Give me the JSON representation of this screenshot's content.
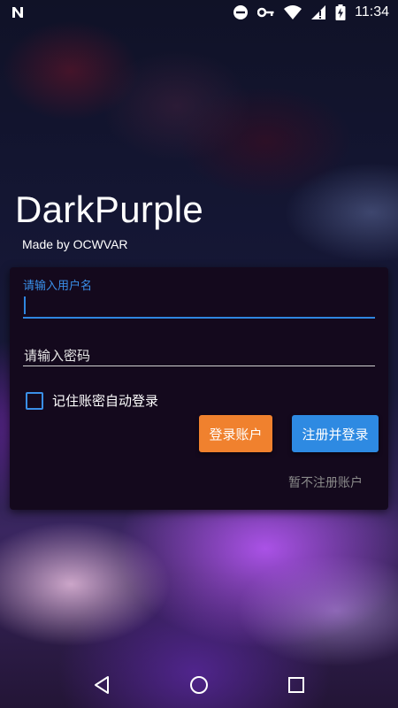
{
  "status_bar": {
    "time": "11:34",
    "icons": [
      "n-logo-icon",
      "do-not-disturb-icon",
      "vpn-key-icon",
      "wifi-icon",
      "signal-icon",
      "battery-charging-icon"
    ]
  },
  "app": {
    "title": "DarkPurple",
    "subtitle": "Made by OCWVAR"
  },
  "login_form": {
    "username": {
      "label": "请输入用户名",
      "value": ""
    },
    "password": {
      "placeholder": "请输入密码",
      "value": ""
    },
    "remember_label": "记住账密自动登录",
    "remember_checked": false,
    "login_button": "登录账户",
    "register_button": "注册并登录",
    "skip_link": "暂不注册账户"
  },
  "colors": {
    "accent_blue": "#2e8ae2",
    "login_orange": "#f0812e",
    "card_bg": "#14091d",
    "skip_gray": "#8a8a8a"
  },
  "nav_bar": {
    "icons": [
      "back-icon",
      "home-icon",
      "recents-icon"
    ]
  }
}
